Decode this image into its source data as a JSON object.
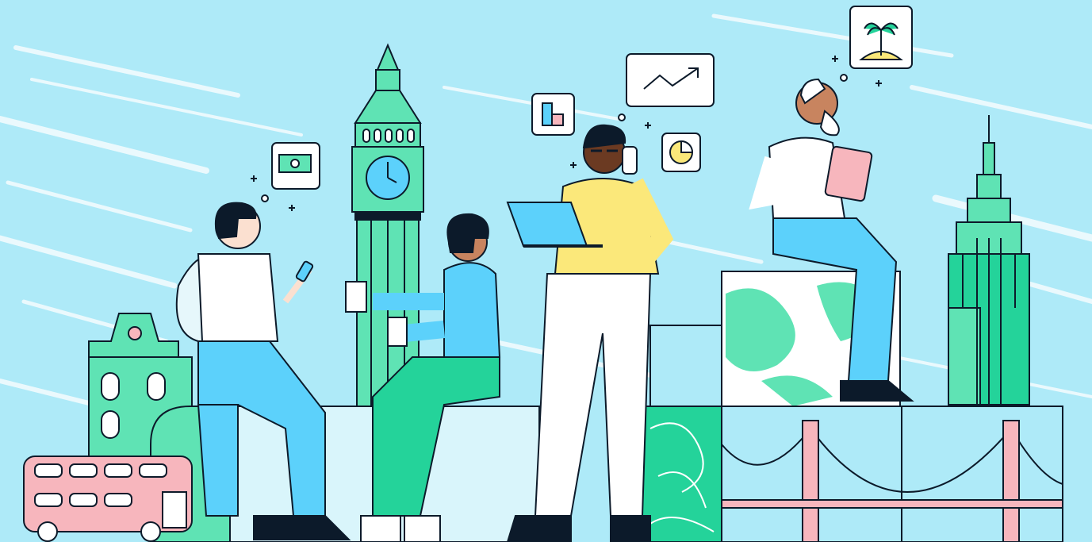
{
  "scene": {
    "palette": {
      "sky": "#aeeaf8",
      "sky_streak": "#ffffff",
      "mint": "#5fe3b4",
      "green": "#24d39a",
      "blue": "#5cd1fb",
      "yellow": "#fbe87a",
      "pink": "#f7b6bd",
      "skin_light": "#fbe0d0",
      "skin_medium": "#c8845f",
      "skin_dark": "#6b3a22",
      "ink": "#0c1a2a",
      "white": "#ffffff"
    },
    "icons": [
      "money-icon",
      "bar-chart-icon",
      "trend-line-icon",
      "pie-chart-icon",
      "palm-tree-island-icon"
    ]
  }
}
